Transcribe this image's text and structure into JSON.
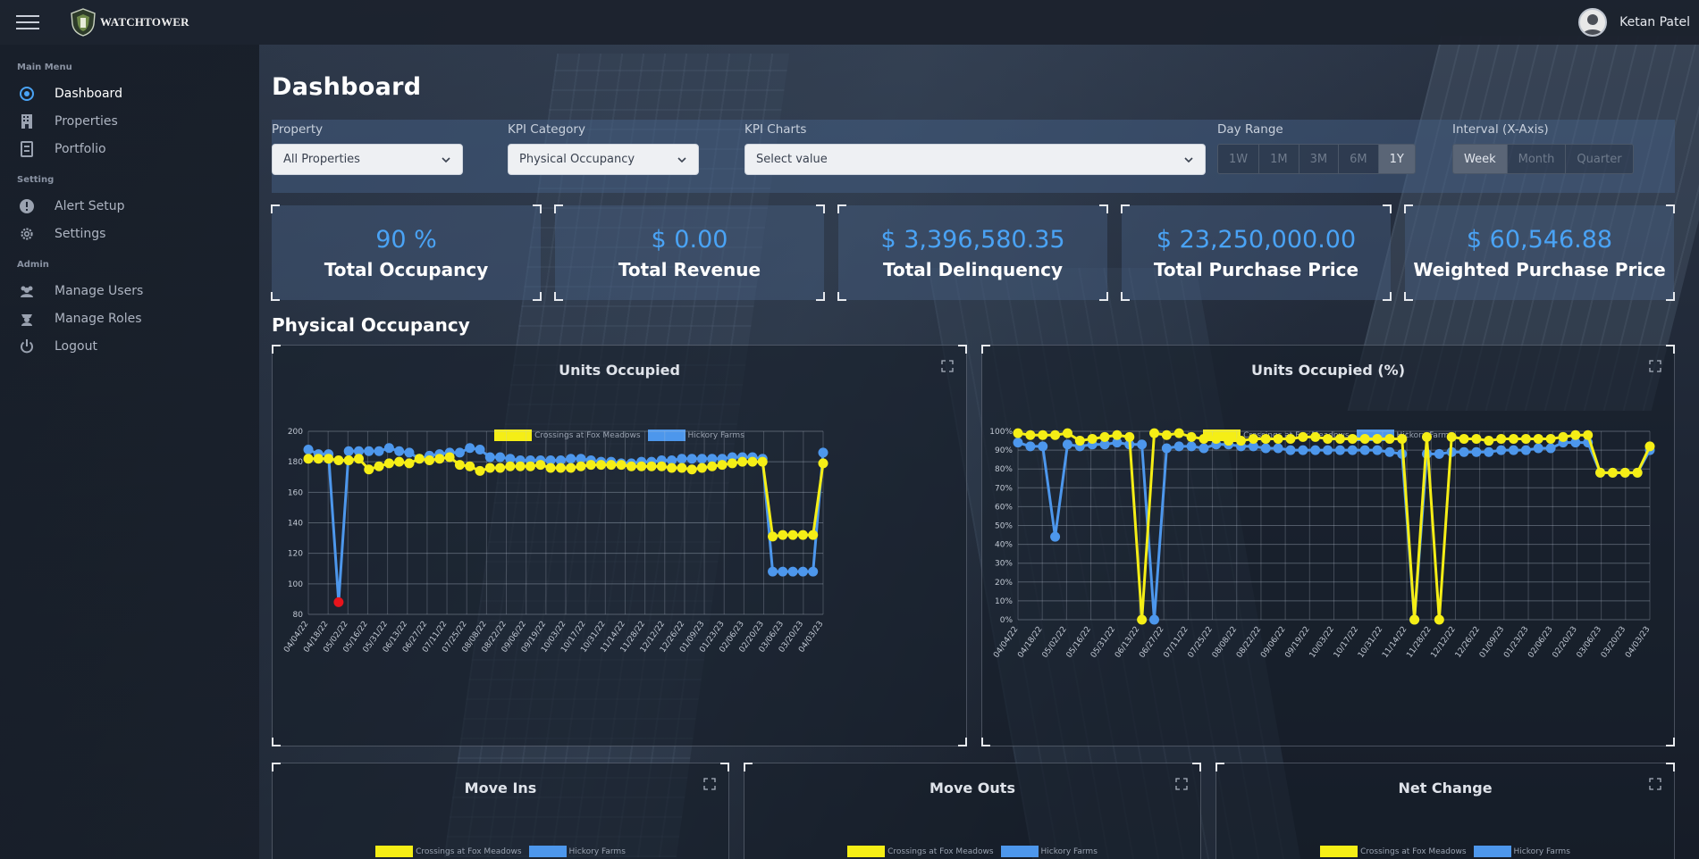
{
  "app": {
    "logo_text": "WATCHTOWER"
  },
  "user": {
    "name": "Ketan Patel"
  },
  "sidebar": {
    "sections": [
      {
        "title": "Main Menu",
        "items": [
          {
            "label": "Dashboard",
            "icon": "dashboard-icon",
            "active": true
          },
          {
            "label": "Properties",
            "icon": "building-icon"
          },
          {
            "label": "Portfolio",
            "icon": "portfolio-icon"
          }
        ]
      },
      {
        "title": "Setting",
        "items": [
          {
            "label": "Alert Setup",
            "icon": "alert-icon"
          },
          {
            "label": "Settings",
            "icon": "gear-icon"
          }
        ]
      },
      {
        "title": "Admin",
        "items": [
          {
            "label": "Manage Users",
            "icon": "users-icon"
          },
          {
            "label": "Manage Roles",
            "icon": "roles-icon"
          },
          {
            "label": "Logout",
            "icon": "power-icon"
          }
        ]
      }
    ]
  },
  "page": {
    "title": "Dashboard",
    "section_title": "Physical Occupancy"
  },
  "filters": {
    "property": {
      "label": "Property",
      "value": "All Properties"
    },
    "kpi_category": {
      "label": "KPI Category",
      "value": "Physical Occupancy"
    },
    "kpi_charts": {
      "label": "KPI Charts",
      "placeholder": "Select value"
    },
    "day_range": {
      "label": "Day Range",
      "options": [
        "1W",
        "1M",
        "3M",
        "6M",
        "1Y"
      ],
      "selected": "1Y"
    },
    "interval": {
      "label": "Interval (X-Axis)",
      "options": [
        "Week",
        "Month",
        "Quarter"
      ],
      "selected": "Week"
    }
  },
  "kpis": [
    {
      "value": "90 %",
      "label": "Total Occupancy"
    },
    {
      "value": "$ 0.00",
      "label": "Total Revenue"
    },
    {
      "value": "$ 3,396,580.35",
      "label": "Total Delinquency"
    },
    {
      "value": "$ 23,250,000.00",
      "label": "Total Purchase Price"
    },
    {
      "value": "$ 60,546.88",
      "label": "Weighted Purchase Price"
    }
  ],
  "colors": {
    "series_a": "#f5ee16",
    "series_b": "#4d97ec",
    "alert": "#e8141c",
    "accent": "#4aa3f5"
  },
  "legend": {
    "series_a": "Crossings at Fox Meadows",
    "series_b": "Hickory Farms"
  },
  "chart_titles": {
    "units": "Units Occupied",
    "units_pct": "Units Occupied (%)",
    "move_ins": "Move Ins",
    "move_outs": "Move Outs",
    "net_change": "Net Change"
  },
  "chart_data": [
    {
      "type": "line",
      "title": "Units Occupied",
      "ylim": [
        80,
        200
      ],
      "yticks": [
        "80",
        "100",
        "120",
        "140",
        "160",
        "180",
        "200"
      ],
      "xtick_labels": [
        "04/04/22",
        "04/18/22",
        "05/02/22",
        "05/16/22",
        "05/31/22",
        "06/13/22",
        "06/27/22",
        "07/11/22",
        "07/25/22",
        "08/08/22",
        "08/22/22",
        "09/06/22",
        "09/19/22",
        "10/03/22",
        "10/17/22",
        "10/31/22",
        "11/14/22",
        "11/28/22",
        "12/12/22",
        "12/26/22",
        "01/09/23",
        "01/23/23",
        "02/06/23",
        "02/20/23",
        "03/06/23",
        "03/20/23",
        "04/03/23"
      ],
      "grid": true,
      "legend_position": "top-center",
      "series": [
        {
          "name": "Crossings at Fox Meadows",
          "values": [
            182,
            182,
            182,
            181,
            181,
            182,
            175,
            177,
            179,
            180,
            179,
            182,
            181,
            182,
            183,
            178,
            177,
            174,
            176,
            176,
            177,
            177,
            177,
            178,
            176,
            176,
            176,
            177,
            178,
            178,
            178,
            178,
            177,
            177,
            177,
            177,
            176,
            176,
            175,
            176,
            177,
            178,
            179,
            180,
            180,
            180,
            131,
            132,
            132,
            132,
            132,
            179
          ]
        },
        {
          "name": "Hickory Farms",
          "values": [
            188,
            185,
            185,
            88,
            187,
            187,
            187,
            187,
            189,
            187,
            186,
            182,
            184,
            185,
            186,
            186,
            189,
            188,
            183,
            183,
            182,
            181,
            181,
            181,
            181,
            181,
            182,
            182,
            181,
            180,
            180,
            179,
            179,
            180,
            180,
            181,
            181,
            182,
            182,
            182,
            182,
            182,
            183,
            183,
            183,
            182,
            108,
            108,
            108,
            108,
            108,
            186
          ]
        }
      ],
      "highlight_points": [
        {
          "series": "Hickory Farms",
          "index": 3,
          "value": 88
        }
      ]
    },
    {
      "type": "line",
      "title": "Units Occupied (%)",
      "ylim": [
        0,
        100
      ],
      "yticks": [
        "0%",
        "10%",
        "20%",
        "30%",
        "40%",
        "50%",
        "60%",
        "70%",
        "80%",
        "90%",
        "100%"
      ],
      "xtick_labels": [
        "04/04/22",
        "04/18/22",
        "05/02/22",
        "05/16/22",
        "05/31/22",
        "06/13/22",
        "06/27/22",
        "07/11/22",
        "07/25/22",
        "08/08/22",
        "08/22/22",
        "09/06/22",
        "09/19/22",
        "10/03/22",
        "10/17/22",
        "10/31/22",
        "11/14/22",
        "11/28/22",
        "12/12/22",
        "12/26/22",
        "01/09/23",
        "01/23/23",
        "02/06/23",
        "02/20/23",
        "03/06/23",
        "03/20/23",
        "04/03/23"
      ],
      "grid": true,
      "legend_position": "top-center",
      "series": [
        {
          "name": "Crossings at Fox Meadows",
          "values": [
            99,
            98,
            98,
            98,
            99,
            95,
            96,
            97,
            98,
            97,
            0,
            99,
            98,
            99,
            97,
            96,
            96,
            95,
            95,
            96,
            96,
            96,
            96,
            97,
            97,
            96,
            96,
            96,
            96,
            96,
            96,
            96,
            0,
            97,
            0,
            97,
            96,
            96,
            95,
            96,
            96,
            96,
            96,
            96,
            97,
            98,
            98,
            78,
            78,
            78,
            78,
            92
          ]
        },
        {
          "name": "Hickory Farms",
          "values": [
            94,
            92,
            92,
            44,
            93,
            92,
            93,
            93,
            94,
            93,
            93,
            0,
            91,
            92,
            92,
            91,
            93,
            93,
            92,
            92,
            91,
            91,
            90,
            90,
            90,
            90,
            90,
            90,
            90,
            90,
            89,
            88,
            0,
            88,
            88,
            89,
            89,
            89,
            89,
            90,
            90,
            90,
            91,
            91,
            94,
            94,
            94,
            78,
            78,
            78,
            78,
            90
          ]
        }
      ]
    },
    {
      "type": "line",
      "title": "Move Ins",
      "series": [
        {
          "name": "Crossings at Fox Meadows",
          "values": []
        },
        {
          "name": "Hickory Farms",
          "values": []
        }
      ]
    },
    {
      "type": "line",
      "title": "Move Outs",
      "series": [
        {
          "name": "Crossings at Fox Meadows",
          "values": []
        },
        {
          "name": "Hickory Farms",
          "values": []
        }
      ]
    },
    {
      "type": "line",
      "title": "Net Change",
      "series": [
        {
          "name": "Crossings at Fox Meadows",
          "values": []
        },
        {
          "name": "Hickory Farms",
          "values": []
        }
      ]
    }
  ]
}
